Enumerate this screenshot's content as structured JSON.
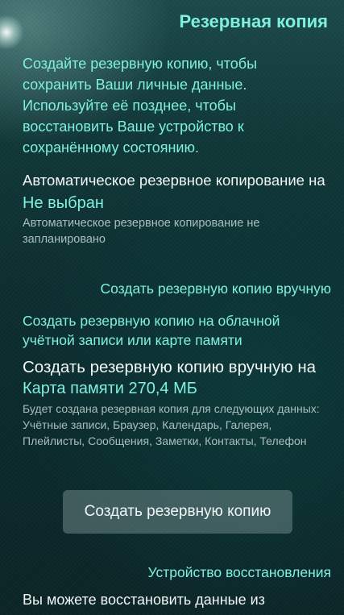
{
  "header": {
    "title": "Резервная копия"
  },
  "intro": {
    "text": "Создайте резервную копию, чтобы сохранить Ваши личные данные. Используйте её позднее, чтобы восстановить Ваше устройство к сохранённому состоянию."
  },
  "auto_backup": {
    "label": "Автоматическое резервное копирование на",
    "value": "Не выбран",
    "description": "Автоматическое резервное копирование не запланировано"
  },
  "manual_section": {
    "header": "Создать резервную копию вручную",
    "cloud_link": "Создать резервную копию на облачной учётной записи или карте памяти",
    "target_label": "Создать резервную копию вручную на",
    "target_value": "Карта памяти 270,4 МБ",
    "target_description": "Будет создана резервная копия для следующих данных: Учётные записи, Браузер, Календарь, Галерея, Плейлисты, Сообщения, Заметки, Контакты, Телефон",
    "button_label": "Создать резервную копию"
  },
  "restore_section": {
    "header": "Устройство восстановления",
    "text": "Вы можете восстановить данные из"
  },
  "colors": {
    "accent": "#7ef0e0",
    "primary_text": "#f1f6f5",
    "background": "#0d2e30"
  }
}
